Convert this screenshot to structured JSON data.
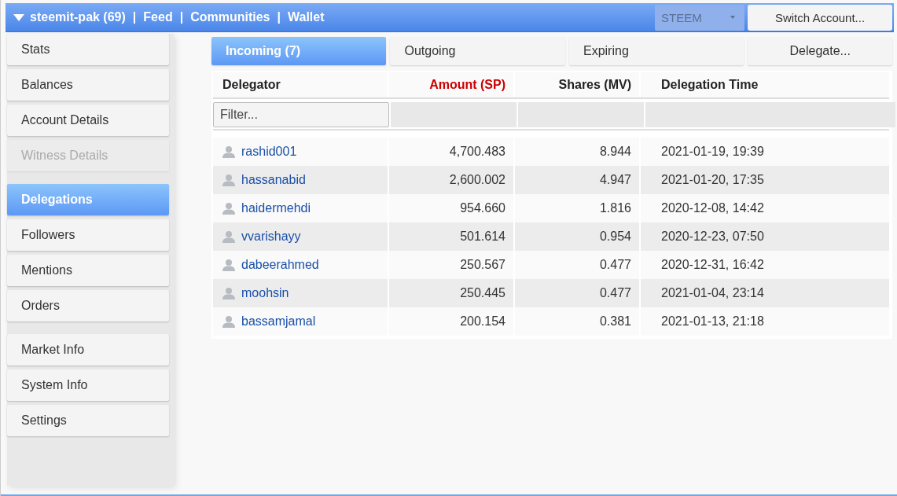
{
  "header": {
    "account": "steemit-pak (69)",
    "links": [
      "Feed",
      "Communities",
      "Wallet"
    ],
    "separator": "|",
    "currency": {
      "value": "STEEM",
      "disabled": true
    },
    "switch_button": "Switch Account..."
  },
  "sidebar": {
    "groups": [
      [
        {
          "label": "Stats",
          "selected": false,
          "disabled": false
        },
        {
          "label": "Balances",
          "selected": false,
          "disabled": false
        },
        {
          "label": "Account Details",
          "selected": false,
          "disabled": false
        },
        {
          "label": "Witness Details",
          "selected": false,
          "disabled": true
        }
      ],
      [
        {
          "label": "Delegations",
          "selected": true,
          "disabled": false
        },
        {
          "label": "Followers",
          "selected": false,
          "disabled": false
        },
        {
          "label": "Mentions",
          "selected": false,
          "disabled": false
        },
        {
          "label": "Orders",
          "selected": false,
          "disabled": false
        }
      ],
      [
        {
          "label": "Market Info",
          "selected": false,
          "disabled": false
        },
        {
          "label": "System Info",
          "selected": false,
          "disabled": false
        },
        {
          "label": "Settings",
          "selected": false,
          "disabled": false
        }
      ]
    ]
  },
  "tabs": [
    {
      "label": "Incoming (7)",
      "selected": true
    },
    {
      "label": "Outgoing",
      "selected": false
    },
    {
      "label": "Expiring",
      "selected": false
    }
  ],
  "delegate_button": "Delegate...",
  "table": {
    "columns": [
      {
        "label": "Delegator",
        "kind": "text",
        "sorted": false
      },
      {
        "label": "Amount (SP)",
        "kind": "number",
        "sorted": true
      },
      {
        "label": "Shares (MV)",
        "kind": "number",
        "sorted": false
      },
      {
        "label": "Delegation Time",
        "kind": "text",
        "sorted": false
      }
    ],
    "filter": {
      "placeholder": "Filter..."
    },
    "rows": [
      [
        "rashid001",
        "4,700.483",
        "8.944",
        "2021-01-19, 19:39"
      ],
      [
        "hassanabid",
        "2,600.002",
        "4.947",
        "2021-01-20, 17:35"
      ],
      [
        "haidermehdi",
        "954.660",
        "1.816",
        "2020-12-08, 14:42"
      ],
      [
        "vvarishayy",
        "501.614",
        "0.954",
        "2020-12-23, 07:50"
      ],
      [
        "dabeerahmed",
        "250.567",
        "0.477",
        "2020-12-31, 16:42"
      ],
      [
        "moohsin",
        "250.445",
        "0.477",
        "2021-01-04, 23:14"
      ],
      [
        "bassamjamal",
        "200.154",
        "0.381",
        "2021-01-13, 21:18"
      ]
    ]
  }
}
